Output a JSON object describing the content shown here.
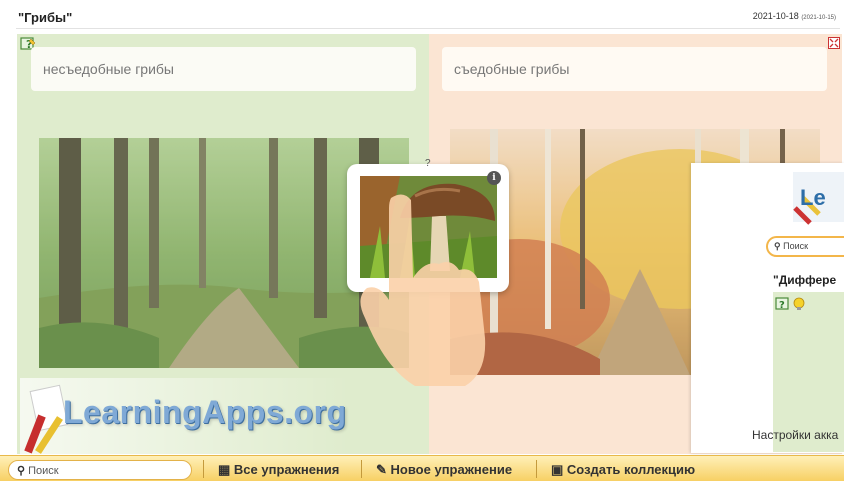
{
  "header": {
    "title": "\"Грибы\"",
    "date": "2021-10-18",
    "date_small": "(2021-10-15)"
  },
  "categories": {
    "left": "несъедобные грибы",
    "right": "съедобные грибы"
  },
  "card": {
    "question_mark": "?",
    "info": "i"
  },
  "overlay": {
    "logo_fragment": "Le",
    "search_placeholder": "Поиск",
    "title_fragment": "\"Диффере",
    "settings_fragment": "Настройки акка"
  },
  "brand": {
    "logo_text": "LearningApps.org"
  },
  "bottom_bar": {
    "search_placeholder": "Поиск",
    "all_exercises": "Все упражнения",
    "new_exercise": "Новое упражнение",
    "create_collection": "Создать коллекцию"
  },
  "colors": {
    "left_panel": "#dfeccd",
    "right_panel": "#fbe5d3",
    "bar": "#f7d064"
  }
}
